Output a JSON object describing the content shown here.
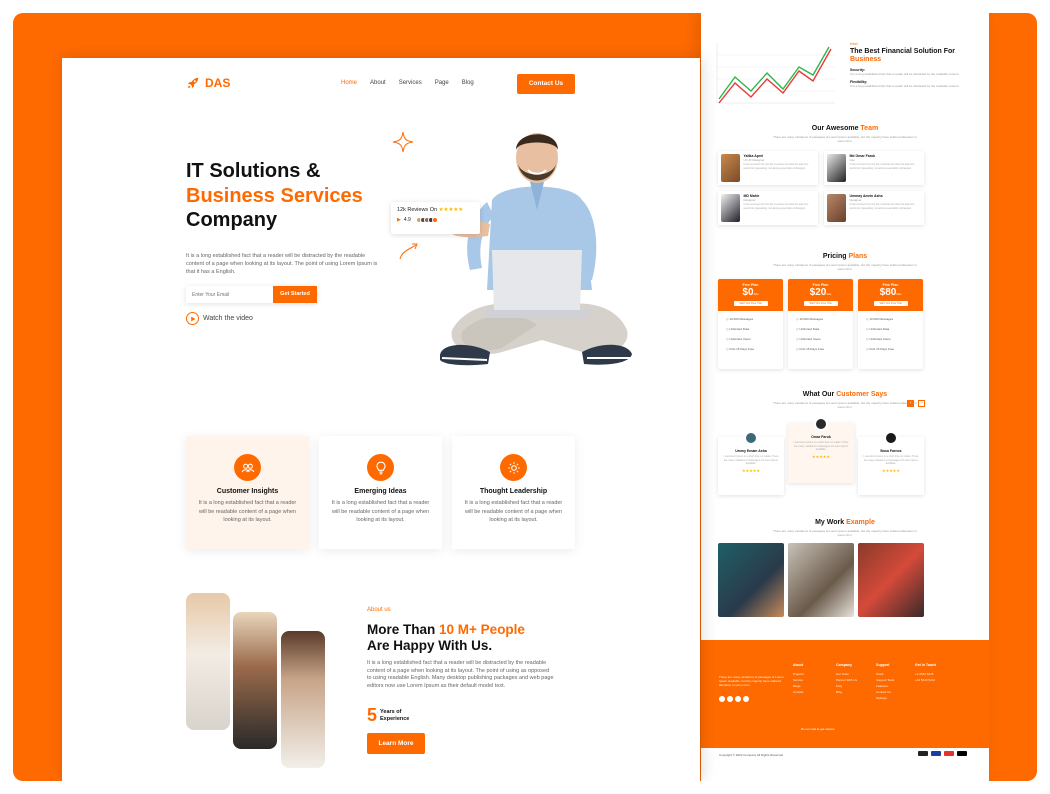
{
  "colors": {
    "accent": "#FF6A00",
    "text": "#111111",
    "muted": "#666666"
  },
  "nav": {
    "logo": "DAS",
    "logo_icon": "rocket-icon",
    "items": [
      "Home",
      "About",
      "Services",
      "Page",
      "Blog"
    ],
    "active": "Home",
    "contact": "Contact Us"
  },
  "hero": {
    "line1": "IT Solutions &",
    "line2": "Business Services",
    "line3": "Company",
    "paragraph": "It is a long established fact that a reader will be distracted by the readable content of a page when looking at its layout. The point of using Lorem Ipsum is that it has a English.",
    "email_placeholder": "Enter Your Email",
    "cta": "Get Started",
    "watch": "Watch the video",
    "reviews_label": "12k Reviews On",
    "stars": "★★★★★",
    "rating": "4.9"
  },
  "features": [
    {
      "icon": "people-icon",
      "title": "Customer Insights",
      "desc": "It is a long established fact that a reader will be readable content of a page when looking at its layout."
    },
    {
      "icon": "lightbulb-icon",
      "title": "Emerging Ideas",
      "desc": "It is a long established fact that a reader will be readable content of a page when looking at its layout."
    },
    {
      "icon": "sun-icon",
      "title": "Thought Leadership",
      "desc": "It is a long established fact that a reader will be readable content of a page when looking at its layout."
    }
  ],
  "about": {
    "tag": "About us",
    "title1": "More Than",
    "title_highlight": "10 M+ People",
    "title2": "Are Happy With Us.",
    "paragraph": "It is a long established fact that a reader will be distracted by the readable content of a page when looking at its layout. The point of using as opposed to using readable English. Many desktop publishing packages and web page editors now use Lorem Ipsum as their default model text.",
    "years": "5",
    "years_label1": "Years of",
    "years_label2": "Experience",
    "button": "Learn More"
  },
  "right": {
    "fin_tag": "Intel",
    "fin_title": "The Best Financial Solution For",
    "fin_highlight": "Business",
    "fin_h1": "Security:",
    "fin_h2": "Flexibility:",
    "fin_p": "It is a long established fact that a reader will be distracted by the readable content.",
    "team_title": "Our Awesome",
    "team_highlight": "Team",
    "section_sub": "There are many variations of passages of Lorem Ipsum available, but the majority have suffered alteration in some form.",
    "team": [
      {
        "name": "Yalika Aprel",
        "role": "UI UX Designer",
        "desc": "It has survived not only five centuries but also the leap into electronic typesetting, remaining essentially unchanged."
      },
      {
        "name": "Md Omar Faruk",
        "role": "Ceo",
        "desc": "It has survived not only five centuries but also the leap into electronic typesetting, remaining essentially unchanged."
      },
      {
        "name": "MD Mahir",
        "role": "Designer",
        "desc": "It has survived not only five centuries but also the leap into electronic typesetting, remaining essentially unchanged."
      },
      {
        "name": "Ummay Amrin Asha",
        "role": "Designer",
        "desc": "It has survived not only five centuries but also the leap into electronic typesetting, remaining essentially unchanged."
      }
    ],
    "pricing_title": "Pricing",
    "pricing_highlight": "Plans",
    "plans": [
      {
        "name": "Free Plan",
        "price": "$0",
        "period": "/Mo",
        "button": "Start Your Free Trial"
      },
      {
        "name": "Free Plan",
        "price": "$20",
        "period": "/Mo",
        "button": "Start Your Free Trial"
      },
      {
        "name": "Free Plan",
        "price": "$80",
        "period": "/Mo",
        "button": "Start Your Free Trial"
      }
    ],
    "plan_features": [
      "10,000 Messages",
      "Unlimited Data",
      "Unlimited Users",
      "First 15 Days Free"
    ],
    "cust_title": "What Our",
    "cust_highlight": "Customer Says",
    "customers": [
      {
        "name": "Ummy Emam Asha",
        "text": "I use lorem ipsum in a short time no matter. There are many variations of passages of Lorem Ipsum available."
      },
      {
        "name": "Omar Faruk",
        "text": "I use lorem ipsum in a short time no matter. There are many variations of passages of Lorem Ipsum available."
      },
      {
        "name": "Bosa Farnos",
        "text": "I use lorem ipsum in a short time no matter. There are many variations of passages of Lorem Ipsum available."
      }
    ],
    "cust_stars": "★★★★★",
    "work_title": "My Work",
    "work_highlight": "Example",
    "footer_cols": [
      {
        "title": "About",
        "items": [
          "Projects",
          "Service",
          "Blogs",
          "Contact"
        ]
      },
      {
        "title": "Company",
        "items": [
          "Our Team",
          "Partner With Us",
          "FAQ",
          "Blog"
        ]
      },
      {
        "title": "Support",
        "items": [
          "Stock",
          "Support Tools",
          "Features",
          "Contact Us",
          "Settings"
        ]
      },
      {
        "title": "Get In Touch",
        "items": [
          "+1 0523 5215",
          "+44 5213 5212"
        ]
      }
    ],
    "footer_text": "There are many variations of passages of Lorem Ipsum available, but the majority have suffered alteration in some form.",
    "footer_copy": "Do not wait to get started",
    "bottom_copy": "Copyright © 2023 Company All Rights Reserved",
    "payments": [
      "amazon",
      "visa",
      "mastercard",
      "apple-pay"
    ]
  }
}
